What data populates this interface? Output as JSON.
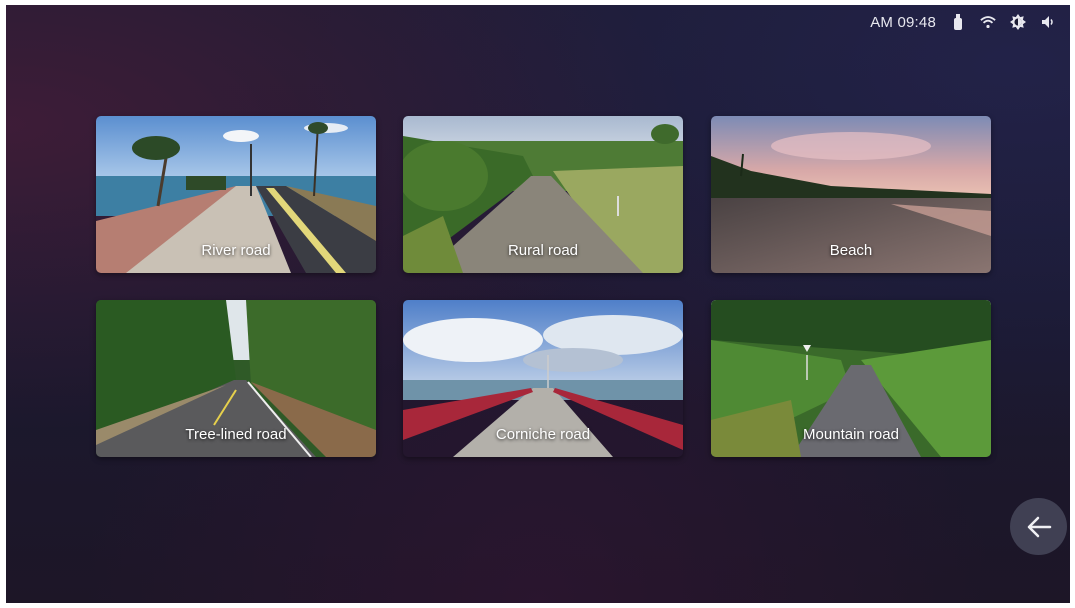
{
  "status_bar": {
    "time": "AM 09:48",
    "icons": [
      "usb-icon",
      "wifi-icon",
      "brightness-icon",
      "volume-icon"
    ]
  },
  "scenes": [
    {
      "label": "River road"
    },
    {
      "label": "Rural road"
    },
    {
      "label": "Beach"
    },
    {
      "label": "Tree-lined road"
    },
    {
      "label": "Corniche road"
    },
    {
      "label": "Mountain road"
    }
  ],
  "back": {
    "icon": "arrow-left-icon"
  }
}
